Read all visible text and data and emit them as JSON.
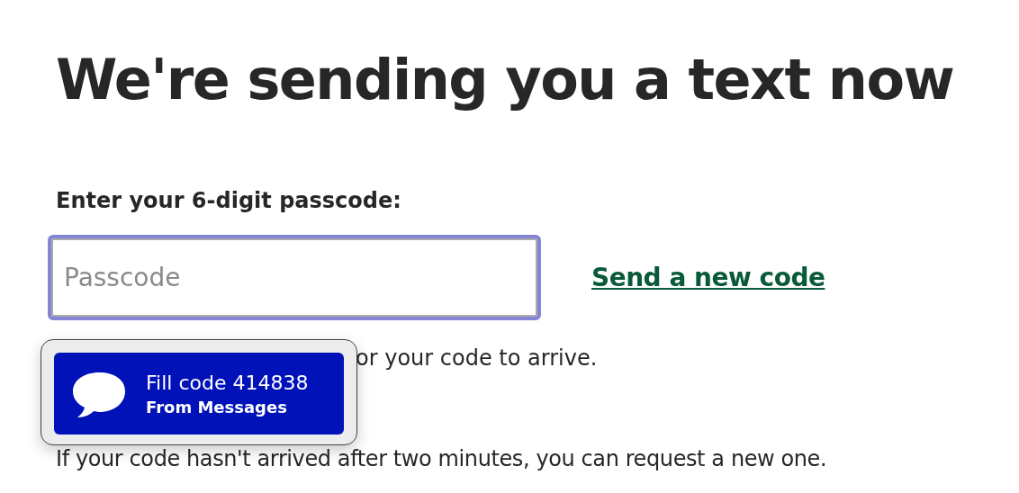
{
  "heading": "We're sending you a text now",
  "label": "Enter your 6-digit passcode:",
  "passcode_field": {
    "placeholder": "Passcode"
  },
  "link": "Send a new code",
  "wait_text": "or your code to arrive.",
  "help_text": "If your code hasn't arrived after two minutes, you can request a new one.",
  "autofill_popup": {
    "title": "Fill code 414838",
    "subtitle": "From Messages"
  }
}
